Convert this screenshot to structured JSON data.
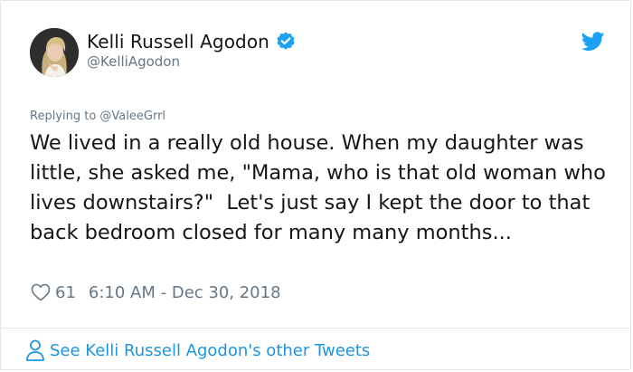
{
  "author": {
    "name": "Kelli Russell Agodon",
    "handle": "@KelliAgodon",
    "verified": true,
    "avatar_icon": "profile-photo"
  },
  "reply": {
    "text": "Replying to @ValeeGrrl"
  },
  "tweet": {
    "text": "We lived in a really old house. When my daughter was little, she asked me, \"Mama, who is that old woman who lives downstairs?\"  Let's just say I kept the door to that back bedroom closed for many many months..."
  },
  "meta": {
    "like_count": "61",
    "timestamp": "6:10 AM - Dec 30, 2018"
  },
  "footer": {
    "link_text": "See Kelli Russell Agodon's other Tweets"
  },
  "colors": {
    "brand_blue": "#1da1f2",
    "link_blue": "#1b95e0",
    "muted": "#657786",
    "text": "#14171a",
    "border": "#e1e8ed"
  },
  "icons": {
    "verified": "verified-badge-icon",
    "bird": "twitter-bird-icon",
    "heart": "heart-icon",
    "person": "person-icon"
  }
}
